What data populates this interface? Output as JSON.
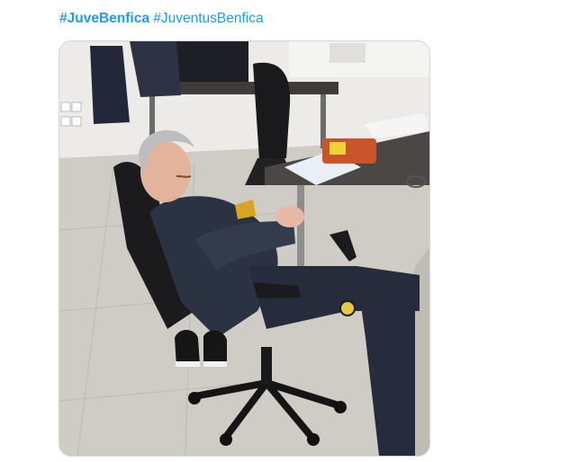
{
  "tweet": {
    "hashtags": [
      "#JuveBenfica",
      "#JuventusBenfica"
    ]
  },
  "media": {
    "alt": "Photo of a man in a navy tracksuit asleep in an office chair next to a desk",
    "colors": {
      "floor": "#cfccc6",
      "wall": "#ecebe7",
      "tracksuit": "#2b3242",
      "desk": "#4a4744",
      "accent_logo": "#d9a521"
    }
  }
}
